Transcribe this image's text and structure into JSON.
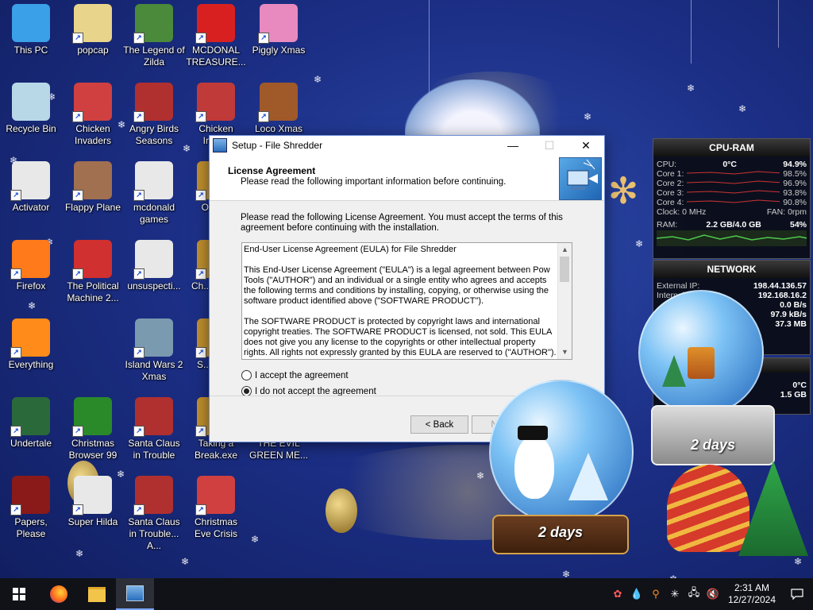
{
  "desktop_icons": [
    {
      "label": "This PC",
      "icon": "computer-icon",
      "color": "#3aa0e8"
    },
    {
      "label": "popcap",
      "icon": "folder-icon",
      "color": "#e8d48a"
    },
    {
      "label": "The Legend of Zilda",
      "icon": "game-icon",
      "color": "#4a8a3a"
    },
    {
      "label": "MCDONAL TREASURE...",
      "icon": "game-icon",
      "color": "#d92020"
    },
    {
      "label": "Piggly Xmas",
      "icon": "game-icon",
      "color": "#e88ac0"
    },
    {
      "label": "Recycle Bin",
      "icon": "recycle-bin-icon",
      "color": "#b8d8e8"
    },
    {
      "label": "Chicken Invaders",
      "icon": "game-icon",
      "color": "#d04040"
    },
    {
      "label": "Angry Birds Seasons",
      "icon": "game-icon",
      "color": "#b03030"
    },
    {
      "label": "Chicken Inva...",
      "icon": "game-icon",
      "color": "#c03a3a"
    },
    {
      "label": "Loco Xmas",
      "icon": "game-icon",
      "color": "#a05a2a"
    },
    {
      "label": "Activator",
      "icon": "file-icon",
      "color": "#e8e8e8"
    },
    {
      "label": "Flappy Plane",
      "icon": "game-icon",
      "color": "#a07050"
    },
    {
      "label": "mcdonald games",
      "icon": "file-icon",
      "color": "#e8e8e8"
    },
    {
      "label": "Orna...",
      "icon": "game-icon",
      "color": "#c09030"
    },
    {
      "label": "Firefox",
      "icon": "firefox-icon",
      "color": "#ff7a1a"
    },
    {
      "label": "The Political Machine 2...",
      "icon": "game-icon",
      "color": "#d03030"
    },
    {
      "label": "unsuspecti...",
      "icon": "file-icon",
      "color": "#e8e8e8"
    },
    {
      "label": "Ch... Swe...",
      "icon": "game-icon",
      "color": "#c09030"
    },
    {
      "label": "Everything",
      "icon": "search-icon",
      "color": "#ff8c1a"
    },
    {
      "label": "Island Wars 2 Xmas",
      "icon": "game-icon",
      "color": "#7a9ab0"
    },
    {
      "label": "S... Ani...",
      "icon": "game-icon",
      "color": "#c09030"
    },
    {
      "label": "Undertale",
      "icon": "game-icon",
      "color": "#2a6a3a"
    },
    {
      "label": "Christmas Browser 99",
      "icon": "tree-icon",
      "color": "#2a8a2a"
    },
    {
      "label": "Santa Claus in Trouble",
      "icon": "game-icon",
      "color": "#b03030"
    },
    {
      "label": "Taking a Break.exe",
      "icon": "game-icon",
      "color": "#c09030"
    },
    {
      "label": "THE EVIL GREEN ME...",
      "icon": "game-icon",
      "color": "#2a8a2a"
    },
    {
      "label": "Papers, Please",
      "icon": "game-icon",
      "color": "#8a1a1a"
    },
    {
      "label": "Super Hilda",
      "icon": "game-icon",
      "color": "#e8e8e8"
    },
    {
      "label": "Santa Claus in Trouble... A...",
      "icon": "game-icon",
      "color": "#b03030"
    },
    {
      "label": "Christmas Eve Crisis",
      "icon": "game-icon",
      "color": "#d04040"
    }
  ],
  "setup_window": {
    "title": "Setup - File Shredder",
    "header_title": "License Agreement",
    "header_subtitle": "Please read the following important information before continuing.",
    "intro": "Please read the following License Agreement. You must accept the terms of this agreement before continuing with the installation.",
    "eula_text": "End-User License Agreement (EULA) for File Shredder\n\nThis End-User License Agreement (\"EULA\") is a legal agreement between Pow Tools (\"AUTHOR\") and an individual or a single entity who agrees and accepts the following terms and conditions by installing, copying, or otherwise using the software product identified above (\"SOFTWARE PRODUCT\").\n\nThe SOFTWARE PRODUCT is protected by copyright laws and international copyright treaties. The SOFTWARE PRODUCT is licensed, not sold. This EULA does not give you any license to the copyrights or other intellectual property rights. All rights not expressly granted by this EULA are reserved to (\"AUTHOR\").",
    "accept_label": "I accept the agreement",
    "decline_label": "I do not accept the agreement",
    "selected": "decline",
    "back_label": "< Back",
    "next_label": "Ne..."
  },
  "cpu_gadget": {
    "title": "CPU-RAM",
    "cpu_label": "CPU:",
    "cpu_temp": "0°C",
    "cpu_value": "94.9%",
    "cores": [
      {
        "label": "Core 1:",
        "value": "98.5%"
      },
      {
        "label": "Core 2:",
        "value": "96.9%"
      },
      {
        "label": "Core 3:",
        "value": "93.8%"
      },
      {
        "label": "Core 4:",
        "value": "90.8%"
      }
    ],
    "clock": "Clock: 0 MHz",
    "fan": "FAN: 0rpm",
    "ram_label": "RAM:",
    "ram_value": "2.2 GB/4.0 GB",
    "ram_percent": "54%"
  },
  "network_gadget": {
    "title": "NETWORK",
    "external_label": "External IP:",
    "external_ip": "198.44.136.57",
    "internal_label": "Internal IP:",
    "internal_ip": "192.168.16.2",
    "rate1": "0.0 B/s",
    "rate2": "97.9 kB/s",
    "rate3": "37.3 MB"
  },
  "extra_gadget": {
    "temp": "0°C",
    "size": "1.5 GB"
  },
  "countdowns": {
    "left": "2 days",
    "right": "2 days"
  },
  "taskbar": {
    "items": [
      {
        "name": "start-button",
        "icon": "windows-icon"
      },
      {
        "name": "taskbar-firefox",
        "icon": "firefox-icon"
      },
      {
        "name": "taskbar-file-explorer",
        "icon": "folder-icon"
      },
      {
        "name": "taskbar-setup",
        "icon": "setup-icon"
      }
    ],
    "time": "2:31 AM",
    "date": "12/27/2024"
  }
}
